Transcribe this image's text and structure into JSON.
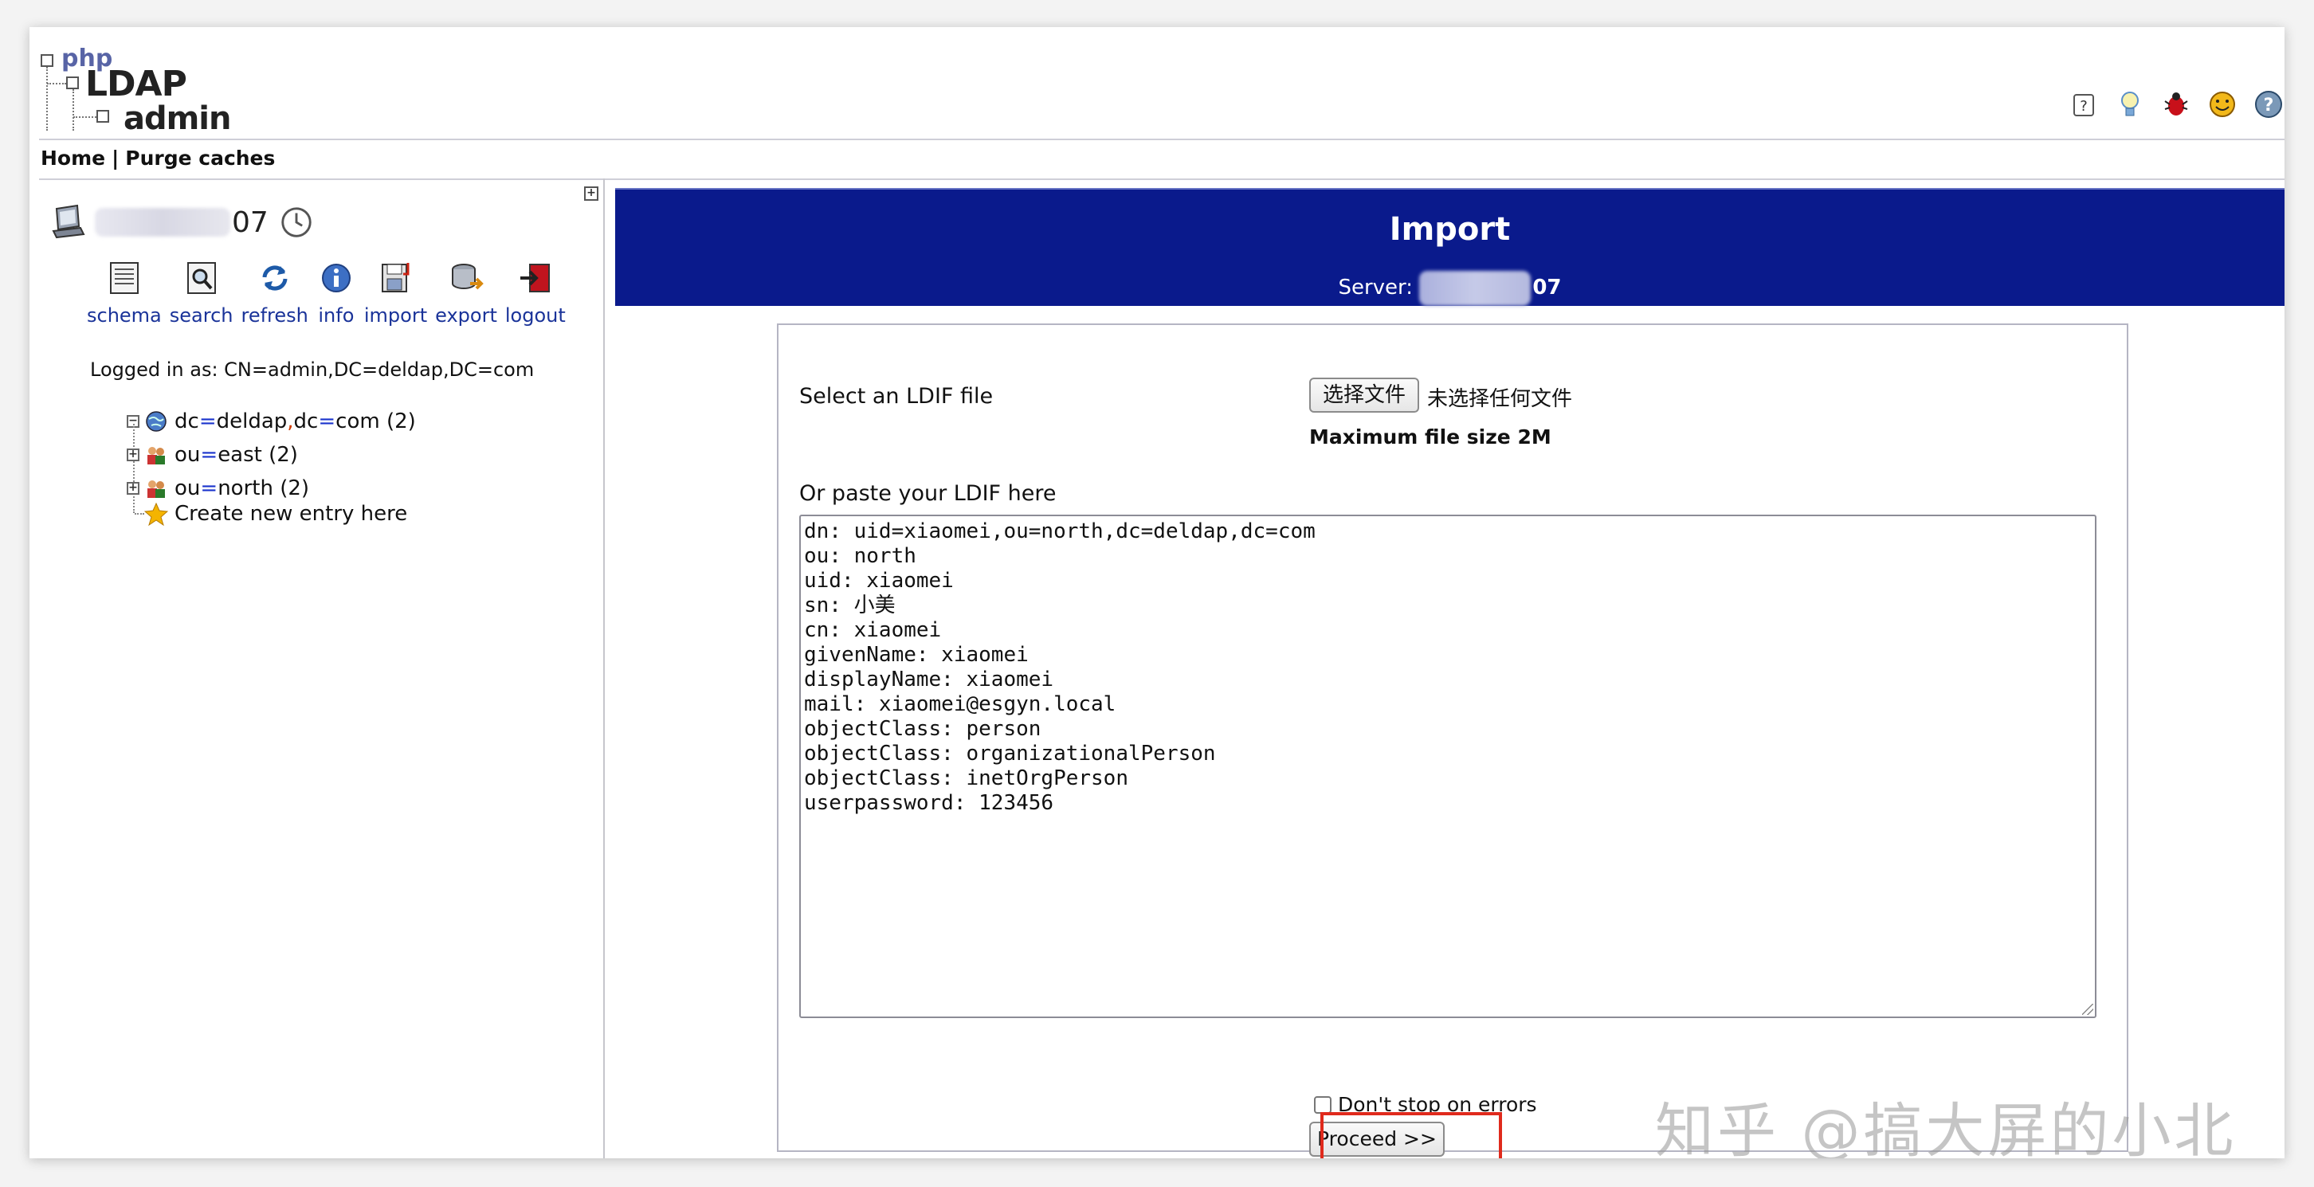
{
  "header": {
    "logo": {
      "php": "php",
      "ldap": "LDAP",
      "admin": "admin"
    },
    "menu": {
      "home": "Home",
      "separator": "|",
      "purge": "Purge caches"
    },
    "top_icons": [
      "help-icon",
      "lightbulb-icon",
      "bug-icon",
      "smiley-icon",
      "question-icon"
    ]
  },
  "sidebar": {
    "server_suffix": "07",
    "tools": [
      {
        "label": "schema",
        "icon": "schema-icon"
      },
      {
        "label": "search",
        "icon": "search-icon"
      },
      {
        "label": "refresh",
        "icon": "refresh-icon"
      },
      {
        "label": "info",
        "icon": "info-icon"
      },
      {
        "label": "import",
        "icon": "import-icon"
      },
      {
        "label": "export",
        "icon": "export-icon"
      },
      {
        "label": "logout",
        "icon": "logout-icon"
      }
    ],
    "logged_in": "Logged in as: CN=admin,DC=deldap,DC=com",
    "tree": {
      "root": {
        "k1": "dc",
        "eq": "=",
        "v1": "deldap",
        "comma": ",",
        "k2": "dc",
        "v2": "com",
        "count": "(2)"
      },
      "children": [
        {
          "key": "ou",
          "eq": "=",
          "value": "east",
          "count": "(2)"
        },
        {
          "key": "ou",
          "eq": "=",
          "value": "north",
          "count": "(2)"
        }
      ],
      "create": "Create new entry here"
    }
  },
  "main": {
    "title": "Import",
    "server_label": "Server:",
    "server_suffix": "07",
    "select_label": "Select an LDIF file",
    "file_button": "选择文件",
    "no_file": "未选择任何文件",
    "max_size": "Maximum file size 2M",
    "paste_label": "Or paste your LDIF here",
    "ldif_lines": [
      "dn: uid=xiaomei,ou=north,dc=deldap,dc=com",
      "ou: north",
      "uid: xiaomei",
      "sn: 小美",
      "cn: xiaomei",
      "givenName: xiaomei",
      "displayName: xiaomei",
      "mail: xiaomei@esgyn.local",
      "objectClass: person",
      "objectClass: organizationalPerson",
      "objectClass: inetOrgPerson",
      "userpassword: 123456"
    ],
    "checkbox_label": "Don't stop on errors",
    "proceed": "Proceed >>"
  },
  "watermark": "知乎 @搞大屏的小北",
  "colors": {
    "banner": "#0a1a8c",
    "link": "#1a3399",
    "highlight": "#e02a1c"
  }
}
